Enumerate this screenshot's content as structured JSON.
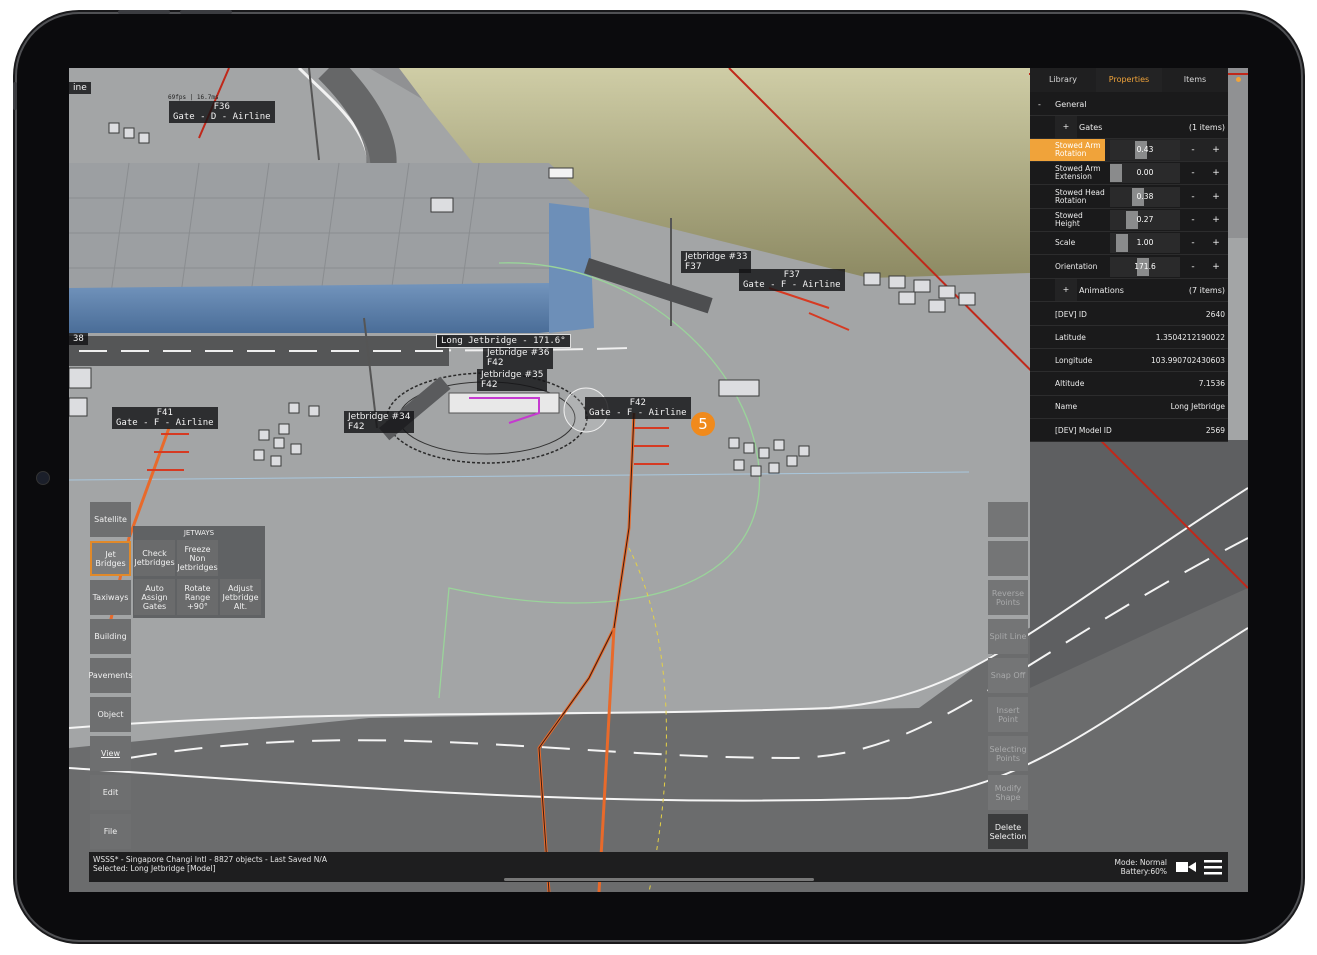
{
  "colors": {
    "accent": "#f0a33a",
    "badge": "#f08a1c",
    "red_line": "#c0281a",
    "orange_line": "#e86a2b"
  },
  "tabs": [
    "Library",
    "Properties",
    "Items"
  ],
  "properties": {
    "general_label": "General",
    "general_toggle": "-",
    "gates_label": "Gates",
    "gates_toggle": "+",
    "gates_count": "(1 items)",
    "sliders": [
      {
        "label": "Stowed Arm Rotation",
        "value": "0.43",
        "level": 0.43
      },
      {
        "label": "Stowed Arm Extension",
        "value": "0.00",
        "level": 0.0
      },
      {
        "label": "Stowed Head Rotation",
        "value": "0.38",
        "level": 0.38
      },
      {
        "label": "Stowed Height",
        "value": "0.27",
        "level": 0.27
      },
      {
        "label": "Scale",
        "value": "1.00",
        "level": 0.1
      },
      {
        "label": "Orientation",
        "value": "171.6",
        "level": 0.47
      }
    ],
    "minus": "-",
    "plus": "+",
    "animations_label": "Animations",
    "animations_toggle": "+",
    "animations_count": "(7 items)",
    "info": [
      {
        "label": "[DEV] ID",
        "value": "2640"
      },
      {
        "label": "Latitude",
        "value": "1.3504212190022"
      },
      {
        "label": "Longitude",
        "value": "103.990702430603"
      },
      {
        "label": "Altitude",
        "value": "7.1536"
      },
      {
        "label": "Name",
        "value": "Long Jetbridge"
      },
      {
        "label": "[DEV] Model ID",
        "value": "2569"
      }
    ]
  },
  "left_tools": [
    "Satellite",
    "Jet Bridges",
    "Taxiways",
    "Building",
    "Pavements",
    "Object",
    "View",
    "Edit",
    "File"
  ],
  "jetways": {
    "title": "JETWAYS",
    "buttons": [
      "Check Jetbridges",
      "Freeze Non Jetbridges",
      "Auto Assign Gates",
      "Rotate Range +90°",
      "Adjust Jetbridge Alt."
    ]
  },
  "right_tools": [
    "",
    "",
    "Reverse Points",
    "Split Line",
    "Snap Off",
    "Insert Point",
    "Selecting Points",
    "Modify Shape",
    "Delete Selection"
  ],
  "scene_labels": {
    "fps": "69fps | 16.7ms",
    "f36": "F36\nGate - D - Airline",
    "f37": "F37\nGate - F - Airline",
    "f38": "38",
    "f41": "F41\nGate - F - Airline",
    "f42": "F42\nGate - F - Airline",
    "jb33": "Jetbridge #33\nF37",
    "jb34": "Jetbridge #34\nF42",
    "jb35": "Jetbridge #35\nF42",
    "jb36": "Jetbridge #36\nF42",
    "long_jb": "Long Jetbridge - 171.6°",
    "ine": "ine"
  },
  "badge": "5",
  "status": {
    "line1": "WSSS* - Singapore Changi Intl - 8827 objects - Last Saved N/A",
    "line2": "Selected: Long Jetbridge [Model]",
    "mode": "Mode: Normal",
    "battery": "Battery:60%"
  }
}
